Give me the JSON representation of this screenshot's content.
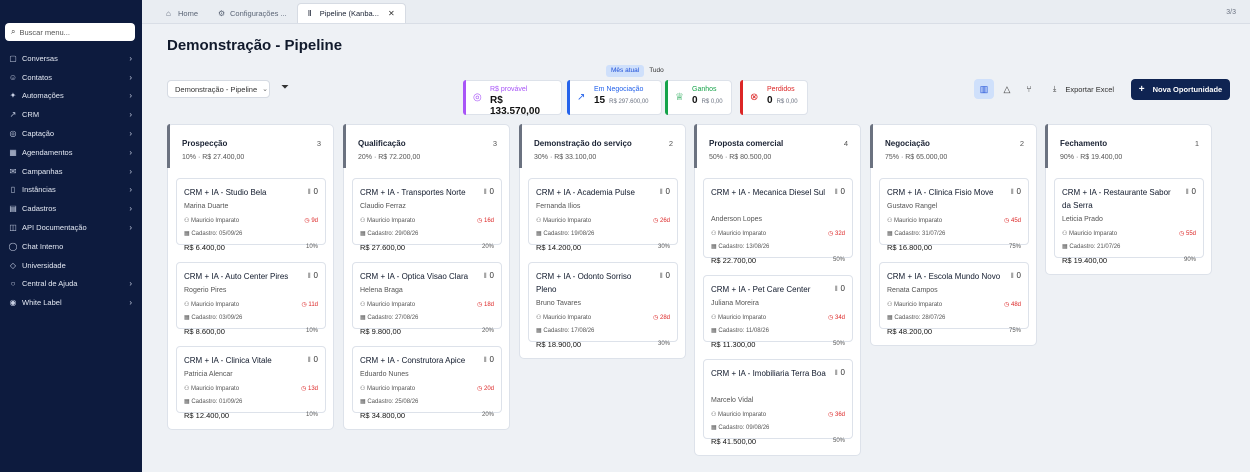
{
  "sidebar": {
    "search_placeholder": "Buscar menu...",
    "items": [
      {
        "icon": "message-icon",
        "glyph": "▢",
        "label": "Conversas",
        "chevron": true
      },
      {
        "icon": "contacts-icon",
        "glyph": "☺",
        "label": "Contatos",
        "chevron": true
      },
      {
        "icon": "automation-icon",
        "glyph": "✦",
        "label": "Automações",
        "chevron": true
      },
      {
        "icon": "crm-icon",
        "glyph": "↗",
        "label": "CRM",
        "chevron": true
      },
      {
        "icon": "capture-icon",
        "glyph": "◎",
        "label": "Captação",
        "chevron": true
      },
      {
        "icon": "calendar-icon",
        "glyph": "▦",
        "label": "Agendamentos",
        "chevron": true
      },
      {
        "icon": "campaign-icon",
        "glyph": "✉",
        "label": "Campanhas",
        "chevron": true
      },
      {
        "icon": "instances-icon",
        "glyph": "▯",
        "label": "Instâncias",
        "chevron": true
      },
      {
        "icon": "registry-icon",
        "glyph": "▤",
        "label": "Cadastros",
        "chevron": true
      },
      {
        "icon": "api-docs-icon",
        "glyph": "◫",
        "label": "API Documentação",
        "chevron": true
      },
      {
        "icon": "chat-icon",
        "glyph": "◯",
        "label": "Chat Interno",
        "chevron": false
      },
      {
        "icon": "university-icon",
        "glyph": "◇",
        "label": "Universidade",
        "chevron": false
      },
      {
        "icon": "help-icon",
        "glyph": "○",
        "label": "Central de Ajuda",
        "chevron": true
      },
      {
        "icon": "white-label-icon",
        "glyph": "◉",
        "label": "White Label",
        "chevron": true
      }
    ]
  },
  "tabs": [
    {
      "label": "Home",
      "icon": "home-icon",
      "glyph": "⌂",
      "active": false
    },
    {
      "label": "Configurações ...",
      "icon": "gear-icon",
      "glyph": "⚙",
      "active": false
    },
    {
      "label": "Pipeline (Kanba...",
      "icon": "pipeline-icon",
      "glyph": "Ⅱ",
      "active": true
    }
  ],
  "tab_count": "3/3",
  "page": {
    "title": "Demonstração - Pipeline",
    "pipeline_select": "Demonstração - Pipeline",
    "period_options": [
      "Mês atual",
      "Tudo"
    ],
    "export_label": "Exportar Excel",
    "new_label": "Nova Oportunidade"
  },
  "kpis": [
    {
      "label": "R$ provável",
      "value": "R$ 133.570,00",
      "small": "",
      "color": "#a855f7",
      "icon": "target-icon",
      "glyph": "◎"
    },
    {
      "label": "Em Negociação",
      "value": "15",
      "small": "R$ 297.600,00",
      "color": "#2563eb",
      "icon": "trend-icon",
      "glyph": "↗"
    },
    {
      "label": "Ganhos",
      "value": "0",
      "small": "R$ 0,00",
      "color": "#16a34a",
      "icon": "trophy-icon",
      "glyph": "♕"
    },
    {
      "label": "Perdidos",
      "value": "0",
      "small": "R$ 0,00",
      "color": "#dc2626",
      "icon": "x-circle-icon",
      "glyph": "⊗"
    }
  ],
  "columns": [
    {
      "title": "Prospecção",
      "count": "3",
      "summary": "10% · R$ 27.400,00",
      "cards": [
        {
          "title": "CRM + IA - Studio Bela",
          "q": "0",
          "contact": "Marina Duarte",
          "owner": "Mauricio Imparato",
          "days": "9d",
          "created": "Cadastro: 05/09/26",
          "value": "R$ 6.400,00",
          "pct": "10%"
        },
        {
          "title": "CRM + IA - Auto Center Pires",
          "q": "0",
          "contact": "Rogerio Pires",
          "owner": "Mauricio Imparato",
          "days": "11d",
          "created": "Cadastro: 03/09/26",
          "value": "R$ 8.600,00",
          "pct": "10%"
        },
        {
          "title": "CRM + IA - Clinica Vitale",
          "q": "0",
          "contact": "Patricia Alencar",
          "owner": "Mauricio Imparato",
          "days": "13d",
          "created": "Cadastro: 01/09/26",
          "value": "R$ 12.400,00",
          "pct": "10%"
        }
      ]
    },
    {
      "title": "Qualificação",
      "count": "3",
      "summary": "20% · R$ 72.200,00",
      "cards": [
        {
          "title": "CRM + IA - Transportes Norte",
          "q": "0",
          "contact": "Claudio Ferraz",
          "owner": "Mauricio Imparato",
          "days": "16d",
          "created": "Cadastro: 29/08/26",
          "value": "R$ 27.600,00",
          "pct": "20%"
        },
        {
          "title": "CRM + IA - Optica Visao Clara",
          "q": "0",
          "contact": "Helena Braga",
          "owner": "Mauricio Imparato",
          "days": "18d",
          "created": "Cadastro: 27/08/26",
          "value": "R$ 9.800,00",
          "pct": "20%"
        },
        {
          "title": "CRM + IA - Construtora Apice",
          "q": "0",
          "contact": "Eduardo Nunes",
          "owner": "Mauricio Imparato",
          "days": "20d",
          "created": "Cadastro: 25/08/26",
          "value": "R$ 34.800,00",
          "pct": "20%"
        }
      ]
    },
    {
      "title": "Demonstração do serviço",
      "count": "2",
      "summary": "30% · R$ 33.100,00",
      "cards": [
        {
          "title": "CRM + IA - Academia Pulse",
          "q": "0",
          "contact": "Fernanda Ilios",
          "owner": "Mauricio Imparato",
          "days": "26d",
          "created": "Cadastro: 19/08/26",
          "value": "R$ 14.200,00",
          "pct": "30%"
        },
        {
          "title": "CRM + IA - Odonto Sorriso Pleno",
          "q": "0",
          "contact": "Bruno Tavares",
          "owner": "Mauricio Imparato",
          "days": "28d",
          "created": "Cadastro: 17/08/26",
          "value": "R$ 18.900,00",
          "pct": "30%"
        }
      ]
    },
    {
      "title": "Proposta comercial",
      "count": "4",
      "summary": "50% · R$ 80.500,00",
      "cards": [
        {
          "title": "CRM + IA - Mecanica Diesel Sul",
          "q": "0",
          "contact": "Anderson Lopes",
          "owner": "Mauricio Imparato",
          "days": "32d",
          "created": "Cadastro: 13/08/26",
          "value": "R$ 22.700,00",
          "pct": "50%"
        },
        {
          "title": "CRM + IA - Pet Care Center",
          "q": "0",
          "contact": "Juliana Moreira",
          "owner": "Mauricio Imparato",
          "days": "34d",
          "created": "Cadastro: 11/08/26",
          "value": "R$ 11.300,00",
          "pct": "50%"
        },
        {
          "title": "CRM + IA - Imobiliaria Terra Boa",
          "q": "0",
          "contact": "Marcelo Vidal",
          "owner": "Mauricio Imparato",
          "days": "36d",
          "created": "Cadastro: 09/08/26",
          "value": "R$ 41.500,00",
          "pct": "50%"
        }
      ]
    },
    {
      "title": "Negociação",
      "count": "2",
      "summary": "75% · R$ 65.000,00",
      "cards": [
        {
          "title": "CRM + IA - Clinica Fisio Move",
          "q": "0",
          "contact": "Gustavo Rangel",
          "owner": "Mauricio Imparato",
          "days": "45d",
          "created": "Cadastro: 31/07/26",
          "value": "R$ 16.800,00",
          "pct": "75%"
        },
        {
          "title": "CRM + IA - Escola Mundo Novo",
          "q": "0",
          "contact": "Renata Campos",
          "owner": "Mauricio Imparato",
          "days": "48d",
          "created": "Cadastro: 28/07/26",
          "value": "R$ 48.200,00",
          "pct": "75%"
        }
      ]
    },
    {
      "title": "Fechamento",
      "count": "1",
      "summary": "90% · R$ 19.400,00",
      "cards": [
        {
          "title": "CRM + IA - Restaurante Sabor da Serra",
          "q": "0",
          "contact": "Leticia Prado",
          "owner": "Mauricio Imparato",
          "days": "55d",
          "created": "Cadastro: 21/07/26",
          "value": "R$ 19.400,00",
          "pct": "90%"
        }
      ]
    }
  ]
}
